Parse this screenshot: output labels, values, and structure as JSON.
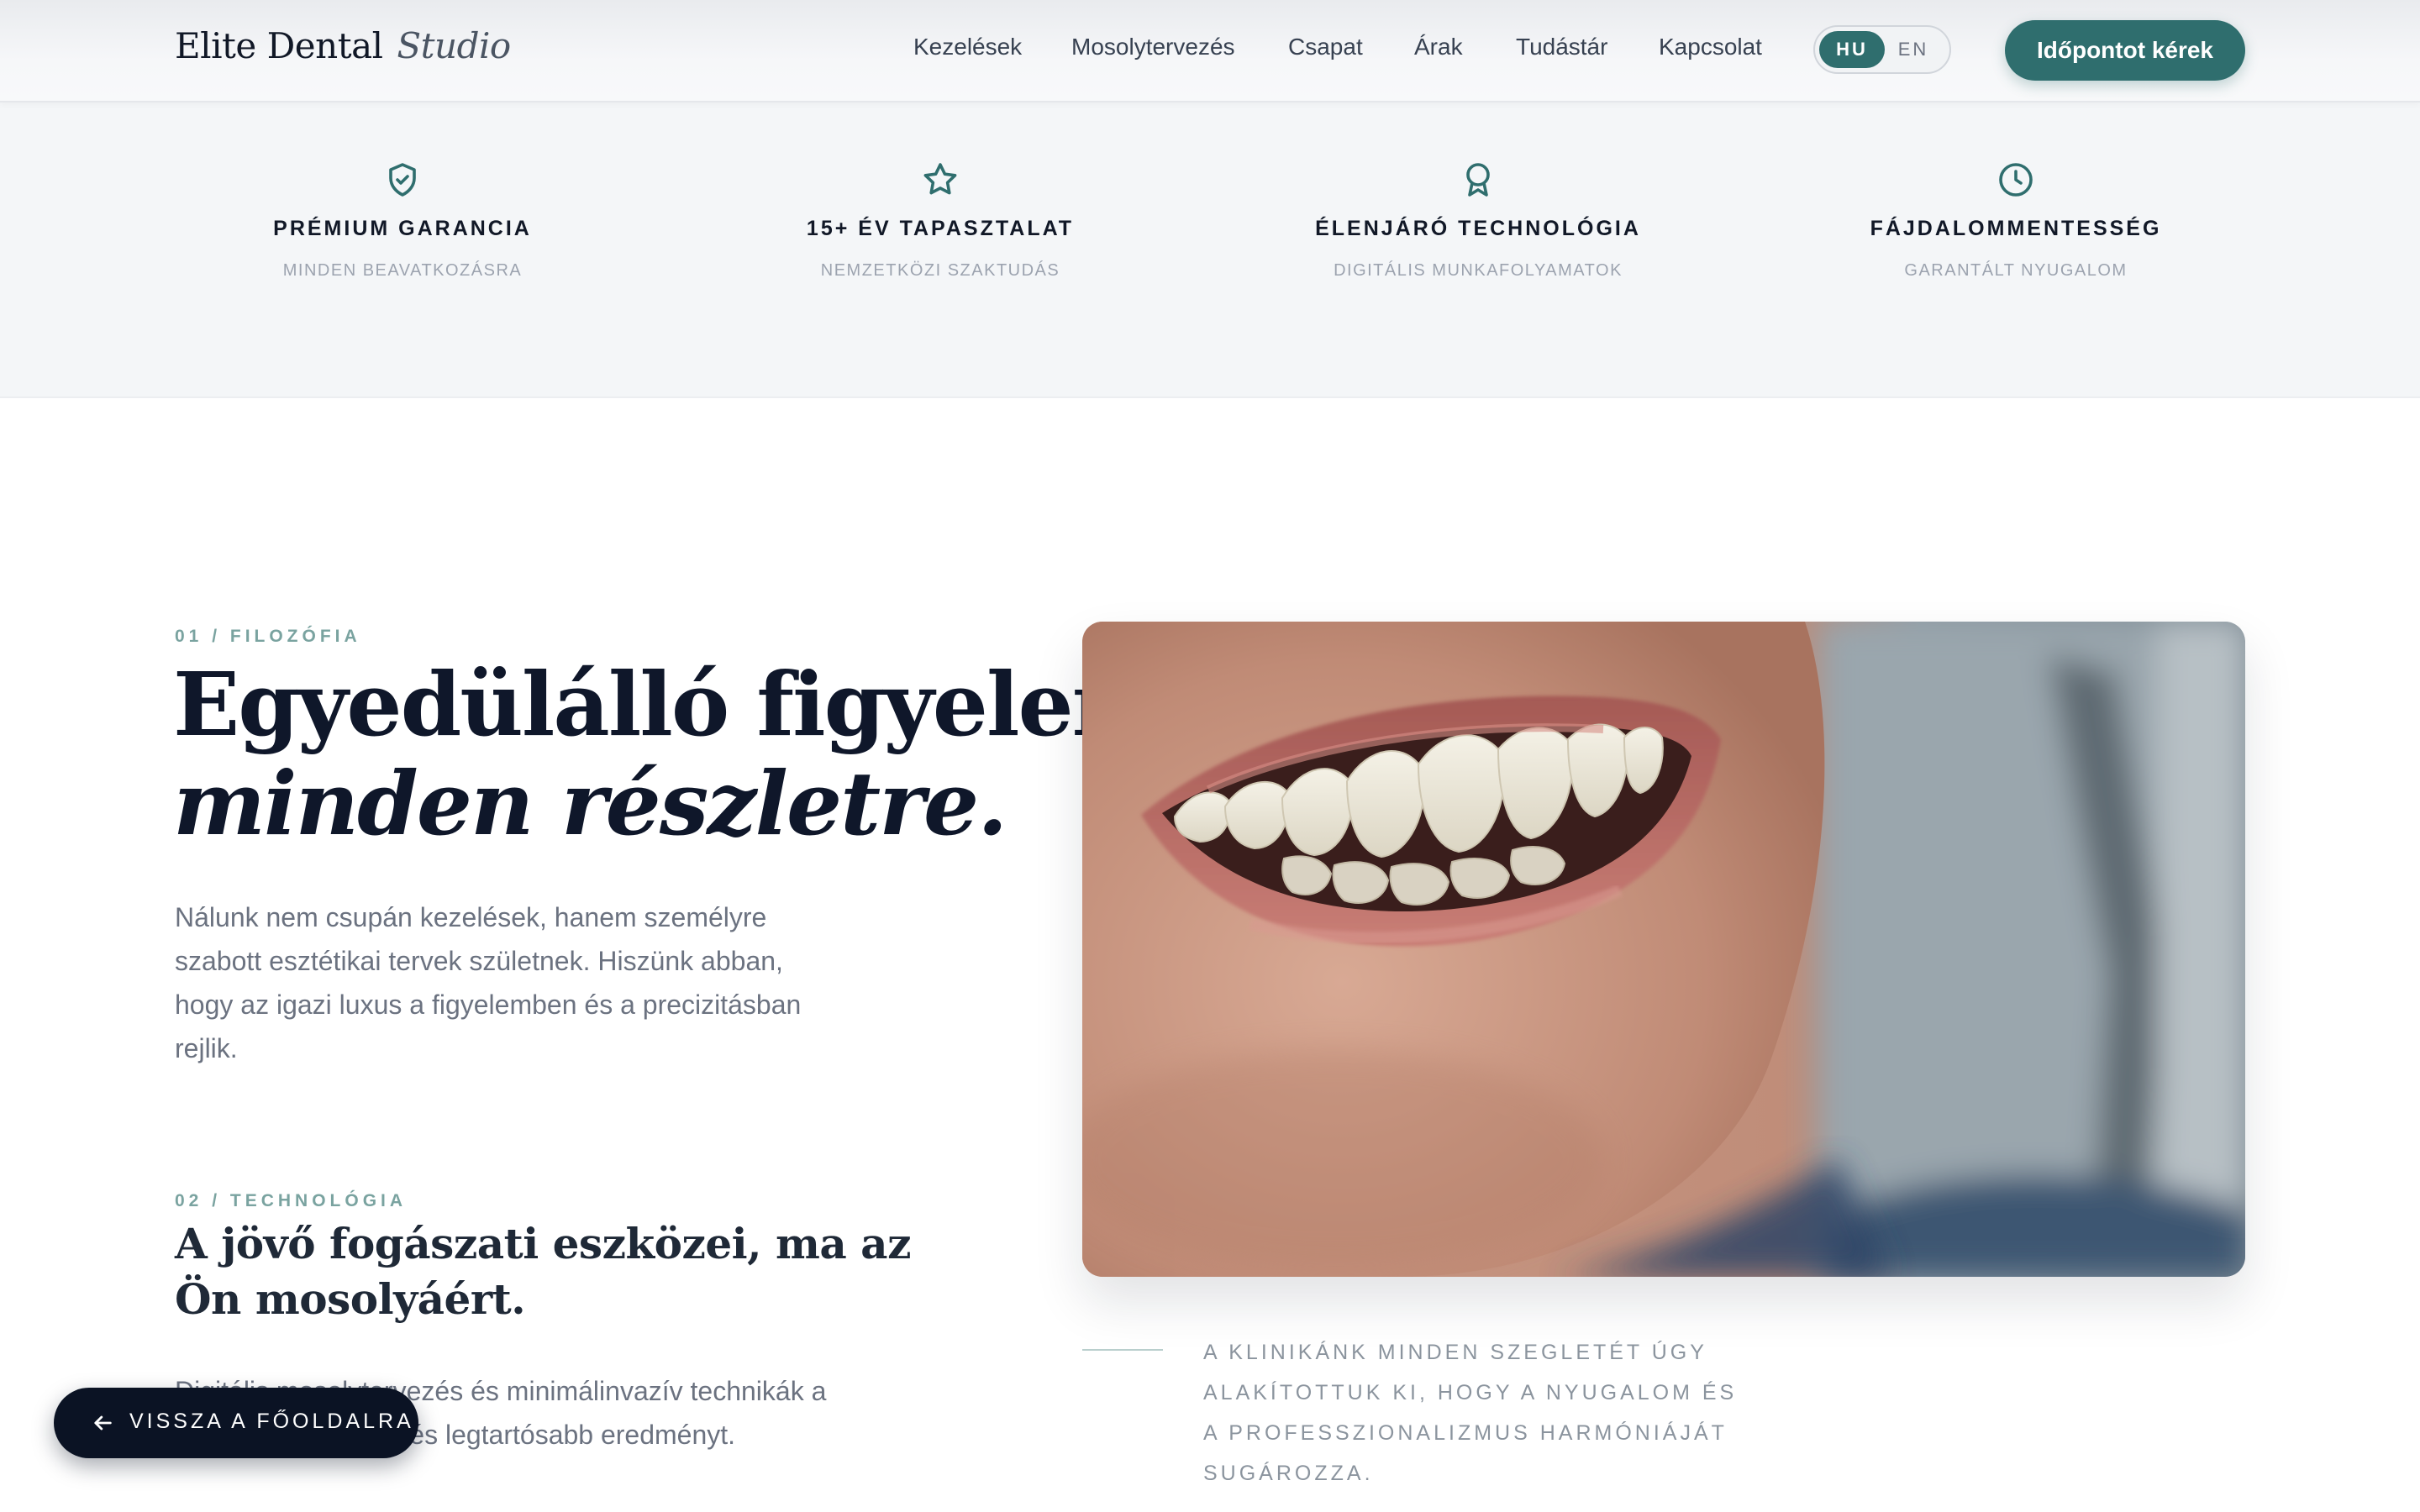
{
  "header": {
    "brand_main": "Elite Dental",
    "brand_italic": "Studio",
    "nav": [
      "Kezelések",
      "Mosolytervezés",
      "Csapat",
      "Árak",
      "Tudástár",
      "Kapcsolat"
    ],
    "languages": [
      "HU",
      "EN"
    ],
    "active_language": "HU",
    "cta_label": "Időpontot kérek"
  },
  "features": [
    {
      "icon": "shield-check-icon",
      "title": "PRÉMIUM GARANCIA",
      "subtitle": "MINDEN BEAVATKOZÁSRA"
    },
    {
      "icon": "star-icon",
      "title": "15+ ÉV TAPASZTALAT",
      "subtitle": "NEMZETKÖZI SZAKTUDÁS"
    },
    {
      "icon": "award-icon",
      "title": "ÉLENJÁRÓ TECHNOLÓGIA",
      "subtitle": "DIGITÁLIS MUNKAFOLYAMATOK"
    },
    {
      "icon": "clock-icon",
      "title": "FÁJDALOMMENTESSÉG",
      "subtitle": "GARANTÁLT NYUGALOM"
    }
  ],
  "philosophy": {
    "eyebrow": "01 / FILOZÓFIA",
    "title_line1": "Egyedülálló figyelem",
    "title_line2": "minden részletre.",
    "body": "Nálunk nem csupán kezelések, hanem személyre szabott esztétikai tervek születnek. Hiszünk abban, hogy az igazi luxus a figyelemben és a precizitásban rejlik."
  },
  "technology": {
    "eyebrow": "02 / TECHNOLÓGIA",
    "title": "A jövő fogászati eszközei, ma az Ön mosolyáért.",
    "body": "Digitális mosolytervezés és minimálinvazív technikák a legtermészetesebb és legtartósabb eredményt."
  },
  "image_caption": "A KLINIKÁNK MINDEN SZEGLETÉT ÚGY ALAKÍTOTTUK KI, HOGY A NYUGALOM ÉS A PROFESSZIONALIZMUS HARMÓNIÁJÁT SUGÁROZZA.",
  "back_button": {
    "icon": "arrow-left-icon",
    "label": "VISSZA A FŐOLDALRA"
  },
  "colors": {
    "accent": "#2f6e6e",
    "dark": "#0b1324",
    "eyebrow": "#7aa3a0",
    "strip_bg": "#f4f6f8"
  }
}
